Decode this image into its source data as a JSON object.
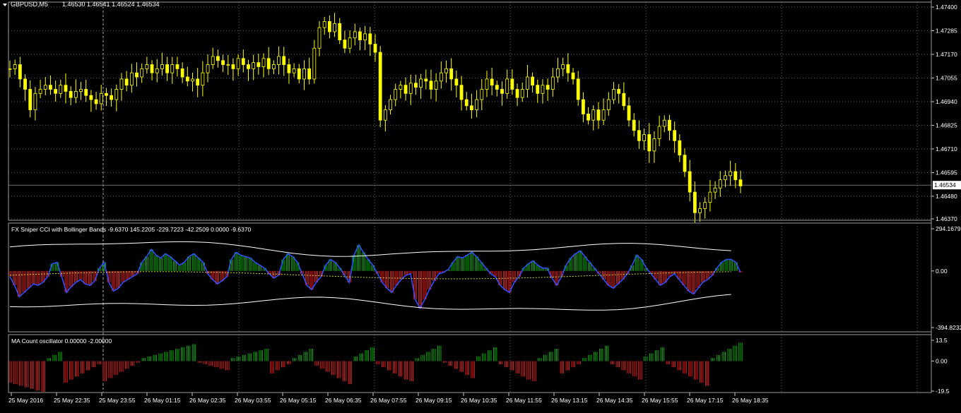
{
  "main_panel": {
    "symbol_label": "GBPUSD,M5",
    "ohlc": "1.46530 1.46541 1.46524 1.46534",
    "price_ticks": [
      "1.47400",
      "1.47285",
      "1.47170",
      "1.47055",
      "1.46940",
      "1.46825",
      "1.46710",
      "1.46595",
      "1.46480",
      "1.46370"
    ],
    "current_price": "1.46534"
  },
  "cci_panel": {
    "title": "FX Sniper CCI with Bollinger Bands  -9.6370 145.2205 -229.7223 -42.2509 0.0000 -9.6370",
    "ticks": [
      "294.1679",
      "0.00",
      "-394.8232"
    ]
  },
  "ma_panel": {
    "title": "MA Count oscillator 0.00000 -2.00000",
    "ticks": [
      "13.5",
      "0.00",
      "-19.5"
    ]
  },
  "time_axis": {
    "labels": [
      "25 May 2016",
      "25 May 22:35",
      "25 May 23:55",
      "26 May 01:15",
      "26 May 02:35",
      "26 May 03:55",
      "26 May 05:15",
      "26 May 06:35",
      "26 May 07:55",
      "26 May 09:15",
      "26 May 10:35",
      "26 May 11:55",
      "26 May 13:15",
      "26 May 14:35",
      "26 May 15:55",
      "26 May 17:15",
      "26 May 18:35"
    ]
  },
  "colors": {
    "candles": "#ffff00",
    "bull_hist": "#00c000",
    "bear_hist": "#ff2020",
    "cci_line": "#3050ff",
    "bands": "#ffffff",
    "grid": "#808080"
  },
  "chart_data": [
    {
      "type": "candlestick",
      "title": "GBPUSD,M5",
      "ylim": [
        1.4637,
        1.474
      ],
      "close_trail": [
        1.471,
        1.4712,
        1.4705,
        1.47,
        1.469,
        1.4698,
        1.47,
        1.4702,
        1.47,
        1.4698,
        1.4702,
        1.4699,
        1.4696,
        1.4699,
        1.47,
        1.4697,
        1.4695,
        1.4693,
        1.4698,
        1.4697,
        1.4695,
        1.47,
        1.4705,
        1.4702,
        1.4708,
        1.4706,
        1.471,
        1.4712,
        1.4708,
        1.471,
        1.4712,
        1.4708,
        1.4712,
        1.471,
        1.4706,
        1.4704,
        1.4705,
        1.4702,
        1.4708,
        1.4712,
        1.4716,
        1.4714,
        1.4712,
        1.4712,
        1.471,
        1.4715,
        1.4712,
        1.471,
        1.4713,
        1.4711,
        1.4715,
        1.471,
        1.4712,
        1.4716,
        1.4712,
        1.4708,
        1.471,
        1.4705,
        1.471,
        1.4705,
        1.472,
        1.473,
        1.4733,
        1.4728,
        1.4732,
        1.4724,
        1.472,
        1.4725,
        1.4728,
        1.4724,
        1.4727,
        1.4722,
        1.4718,
        1.4685,
        1.469,
        1.4695,
        1.47,
        1.4702,
        1.4698,
        1.4703,
        1.4701,
        1.4705,
        1.4704,
        1.47,
        1.4704,
        1.4708,
        1.471,
        1.4705,
        1.4702,
        1.4695,
        1.4692,
        1.469,
        1.4695,
        1.47,
        1.4705,
        1.4702,
        1.47,
        1.4698,
        1.4705,
        1.47,
        1.4696,
        1.47,
        1.4706,
        1.4702,
        1.4698,
        1.4702,
        1.47,
        1.4706,
        1.471,
        1.4712,
        1.4708,
        1.4705,
        1.4695,
        1.4688,
        1.4685,
        1.469,
        1.4685,
        1.469,
        1.4695,
        1.47,
        1.4698,
        1.4692,
        1.4685,
        1.468,
        1.4675,
        1.4678,
        1.467,
        1.4676,
        1.4682,
        1.4685,
        1.468,
        1.4675,
        1.4668,
        1.466,
        1.465,
        1.464,
        1.4642,
        1.4645,
        1.465,
        1.4652,
        1.4656,
        1.4658,
        1.466,
        1.4656,
        1.4653
      ]
    },
    {
      "type": "bar",
      "title": "FX Sniper CCI with Bollinger Bands",
      "ylim": [
        -394.8232,
        294.1679
      ],
      "values": [
        -40,
        -100,
        -180,
        -150,
        -120,
        -90,
        -100,
        -80,
        -40,
        50,
        60,
        -40,
        -150,
        -110,
        -80,
        -60,
        -90,
        -100,
        -70,
        20,
        60,
        -80,
        -140,
        -120,
        -80,
        -60,
        -40,
        -20,
        60,
        100,
        150,
        110,
        90,
        120,
        100,
        70,
        40,
        60,
        100,
        120,
        90,
        60,
        -20,
        -60,
        -90,
        -70,
        -40,
        80,
        130,
        110,
        100,
        90,
        60,
        40,
        20,
        -20,
        -50,
        -30,
        80,
        120,
        100,
        60,
        -20,
        -100,
        -130,
        -80,
        -40,
        40,
        80,
        60,
        20,
        -30,
        -80,
        110,
        180,
        130,
        80,
        40,
        -20,
        -80,
        -120,
        -150,
        -100,
        -60,
        -30,
        -20,
        -200,
        -260,
        -200,
        -130,
        -70,
        -20,
        -10,
        10,
        60,
        100,
        90,
        110,
        130,
        100,
        60,
        20,
        -20,
        -40,
        -100,
        -130,
        -150,
        -80,
        -40,
        20,
        50,
        70,
        40,
        20,
        20,
        -50,
        -100,
        -40,
        40,
        90,
        120,
        140,
        100,
        60,
        20,
        -20,
        -60,
        -100,
        -120,
        -90,
        -60,
        -20,
        40,
        110,
        80,
        20,
        -20,
        -60,
        -100,
        -80,
        -40,
        -20,
        -60,
        -100,
        -140,
        -160,
        -120,
        -80,
        -60,
        -30,
        20,
        60,
        80,
        80,
        60,
        -10
      ]
    },
    {
      "type": "bar",
      "title": "MA Count oscillator",
      "ylim": [
        -19.5,
        13.5
      ],
      "values": [
        -14,
        -15,
        -16,
        -17,
        -18,
        -19,
        -20,
        2,
        4,
        6,
        -14,
        -12,
        -10,
        -8,
        -6,
        -4,
        -2,
        -13,
        -11,
        -9,
        -7,
        -5,
        -3,
        -1,
        2,
        3,
        4,
        5,
        6,
        7,
        8,
        9,
        10,
        11,
        -1,
        -2,
        -3,
        -4,
        -5,
        -6,
        2,
        3,
        4,
        5,
        6,
        7,
        8,
        -8,
        -6,
        -4,
        -2,
        2,
        4,
        6,
        8,
        -3,
        -5,
        -7,
        -9,
        -11,
        -13,
        -15,
        3,
        5,
        7,
        9,
        -2,
        -4,
        -6,
        -8,
        -10,
        -12,
        -13,
        2,
        4,
        6,
        8,
        10,
        -1,
        -3,
        -5,
        -7,
        -9,
        -11,
        3,
        5,
        7,
        9,
        -2,
        -4,
        -6,
        -8,
        -10,
        -12,
        -13,
        2,
        4,
        6,
        8,
        -8,
        -6,
        -4,
        -2,
        2,
        4,
        6,
        8,
        10,
        -2,
        -4,
        -6,
        -8,
        -10,
        -12,
        3,
        5,
        7,
        9,
        -2,
        -4,
        -6,
        -8,
        -10,
        -12,
        -14,
        -16,
        2,
        4,
        6,
        8,
        10,
        12
      ]
    }
  ]
}
